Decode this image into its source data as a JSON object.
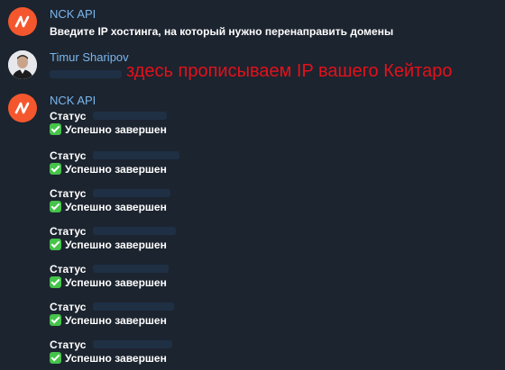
{
  "messages": [
    {
      "sender": "NCK API",
      "avatar_icon": "nck-logo-icon",
      "text": "Введите IP хостинга, на который нужно перенаправить домены"
    },
    {
      "sender": "Timur Sharipov",
      "avatar_icon": "user-avatar-photo",
      "annotation": "здесь прописываем IP вашего Кейтаро"
    },
    {
      "sender": "NCK API",
      "avatar_icon": "nck-logo-icon",
      "statuses": [
        {
          "label": "Статус",
          "result": "Успешно завершен"
        },
        {
          "label": "Статус",
          "result": "Успешно завершен"
        },
        {
          "label": "Статус",
          "result": "Успешно завершен"
        },
        {
          "label": "Статус",
          "result": "Успешно завершен"
        },
        {
          "label": "Статус",
          "result": "Успешно завершен"
        },
        {
          "label": "Статус",
          "result": "Успешно завершен"
        },
        {
          "label": "Статус",
          "result": "Успешно завершен"
        }
      ]
    }
  ],
  "colors": {
    "background": "#1c242f",
    "sender_name": "#7ab7ee",
    "bot_avatar": "#f4572d",
    "annotation": "#e3111b",
    "check": "#45c34a"
  }
}
